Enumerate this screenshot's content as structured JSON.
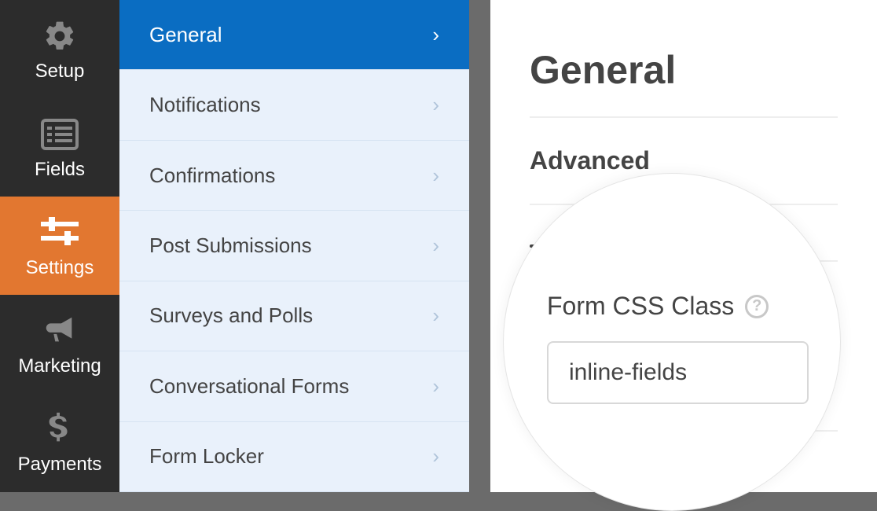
{
  "sidebar": {
    "items": [
      {
        "label": "Setup",
        "icon": "gear",
        "active": false
      },
      {
        "label": "Fields",
        "icon": "list",
        "active": false
      },
      {
        "label": "Settings",
        "icon": "sliders",
        "active": true
      },
      {
        "label": "Marketing",
        "icon": "megaphone",
        "active": false
      },
      {
        "label": "Payments",
        "icon": "dollar",
        "active": false
      }
    ]
  },
  "submenu": {
    "items": [
      {
        "label": "General",
        "active": true
      },
      {
        "label": "Notifications",
        "active": false
      },
      {
        "label": "Confirmations",
        "active": false
      },
      {
        "label": "Post Submissions",
        "active": false
      },
      {
        "label": "Surveys and Polls",
        "active": false
      },
      {
        "label": "Conversational Forms",
        "active": false
      },
      {
        "label": "Form Locker",
        "active": false
      }
    ]
  },
  "main": {
    "title": "General",
    "section": "Advanced",
    "field": {
      "label": "Form CSS Class",
      "value": "inline-fields"
    }
  }
}
